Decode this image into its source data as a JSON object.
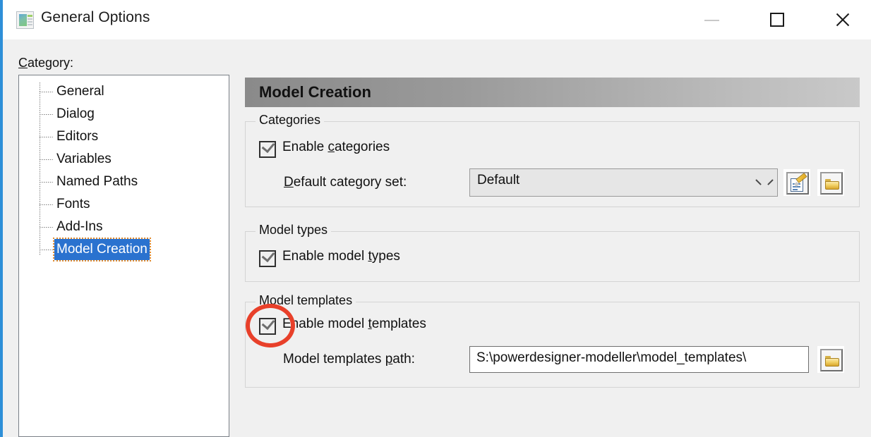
{
  "window": {
    "title": "General Options",
    "icon": "options-window-icon",
    "accent_color": "#2e8fd8",
    "controls": {
      "minimize": "minimize-icon",
      "maximize": "maximize-icon",
      "close": "close-icon"
    }
  },
  "sidebar": {
    "label": "Category:",
    "label_accesskey": "C",
    "items": [
      {
        "label": "General",
        "selected": false
      },
      {
        "label": "Dialog",
        "selected": false
      },
      {
        "label": "Editors",
        "selected": false
      },
      {
        "label": "Variables",
        "selected": false
      },
      {
        "label": "Named Paths",
        "selected": false
      },
      {
        "label": "Fonts",
        "selected": false
      },
      {
        "label": "Add-Ins",
        "selected": false
      },
      {
        "label": "Model Creation",
        "selected": true
      }
    ],
    "selected_color": "#2a72cf",
    "focus_outline_color": "#e08a2e"
  },
  "panel": {
    "header": "Model Creation",
    "groups": {
      "categories": {
        "title": "Categories",
        "checkbox": {
          "label_pre": "Enable ",
          "label_key": "c",
          "label_post": "ategories",
          "checked": true
        },
        "field": {
          "label_pre": "",
          "label_key": "D",
          "label_post": "efault category set:",
          "value": "Default",
          "dropdown_icon": "chevron-down-icon"
        },
        "buttons": [
          {
            "icon": "properties-icon"
          },
          {
            "icon": "folder-icon"
          }
        ]
      },
      "model_types": {
        "title": "Model types",
        "checkbox": {
          "label_pre": "Enable model ",
          "label_key": "t",
          "label_post": "ypes",
          "checked": true
        }
      },
      "model_templates": {
        "title": "Model templates",
        "checkbox": {
          "label_pre": "Enable model ",
          "label_key": "t",
          "label_post": "emplates",
          "checked": true
        },
        "field": {
          "label_pre": "Model templates ",
          "label_key": "p",
          "label_post": "ath:",
          "value": "S:\\powerdesigner-modeller\\model_templates\\"
        },
        "buttons": [
          {
            "icon": "folder-icon"
          }
        ]
      }
    }
  },
  "annotation": {
    "shape": "circle",
    "color": "#e8402a",
    "targets": "enable-model-templates-checkbox"
  }
}
